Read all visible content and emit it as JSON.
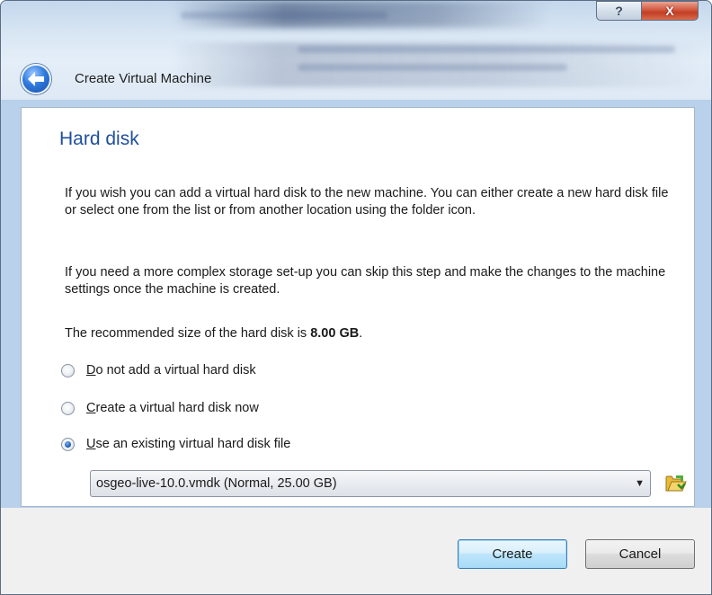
{
  "window": {
    "title": "Create Virtual Machine",
    "help_glyph": "?",
    "close_glyph": "X"
  },
  "page": {
    "section_title": "Hard disk",
    "paragraph1": "If you wish you can add a virtual hard disk to the new machine. You can either create a new hard disk file or select one from the list or from another location using the folder icon.",
    "paragraph2": "If you need a more complex storage set-up you can skip this step and make the changes to the machine settings once the machine is created.",
    "recommended_prefix": "The recommended size of the hard disk is ",
    "recommended_size": "8.00 GB",
    "recommended_suffix": "."
  },
  "options": [
    {
      "mnemonic": "D",
      "rest": "o not add a virtual hard disk",
      "checked": false
    },
    {
      "mnemonic": "C",
      "rest": "reate a virtual hard disk now",
      "checked": false
    },
    {
      "mnemonic": "U",
      "rest": "se an existing virtual hard disk file",
      "checked": true
    }
  ],
  "disk_select": {
    "value": "osgeo-live-10.0.vmdk (Normal, 25.00 GB)"
  },
  "buttons": {
    "create": "Create",
    "cancel": "Cancel"
  },
  "icons": {
    "back": "back-arrow-icon",
    "folder": "folder-open-icon"
  },
  "colors": {
    "title_blue": "#1f4e9c",
    "default_button": "#bee6fd"
  }
}
